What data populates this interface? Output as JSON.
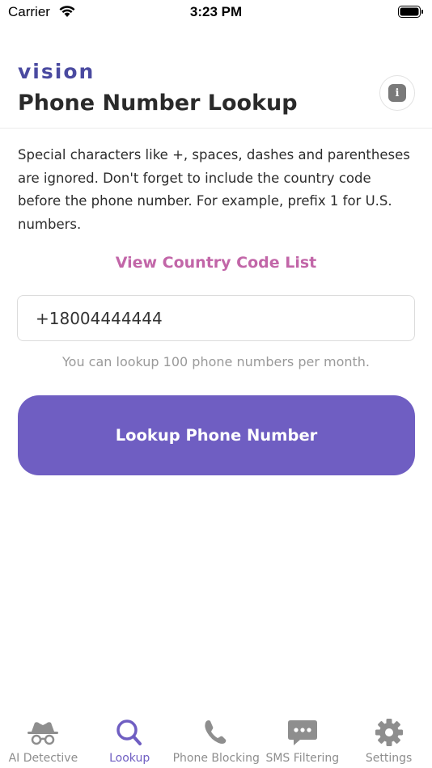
{
  "status_bar": {
    "carrier": "Carrier",
    "time": "3:23 PM"
  },
  "header": {
    "brand": "vision",
    "title": "Phone Number Lookup",
    "info_icon": "info-icon"
  },
  "main": {
    "instructions": "Special characters like +, spaces, dashes and parentheses are ignored. Don't forget to include the country code before the phone number. For example, prefix 1 for U.S. numbers.",
    "country_code_link": "View Country Code List",
    "phone_input_value": "+18004444444",
    "quota_note": "You can lookup 100 phone numbers per month.",
    "lookup_button": "Lookup Phone Number"
  },
  "tabs": [
    {
      "label": "AI Detective",
      "icon": "detective-icon",
      "active": false
    },
    {
      "label": "Lookup",
      "icon": "search-icon",
      "active": true
    },
    {
      "label": "Phone Blocking",
      "icon": "phone-icon",
      "active": false
    },
    {
      "label": "SMS Filtering",
      "icon": "chat-bubble-icon",
      "active": false
    },
    {
      "label": "Settings",
      "icon": "gear-icon",
      "active": false
    }
  ],
  "colors": {
    "accent": "#6f5ec2",
    "brand": "#4a4aa0",
    "link": "#c266a8",
    "inactive_tab": "#8e8e8e"
  }
}
